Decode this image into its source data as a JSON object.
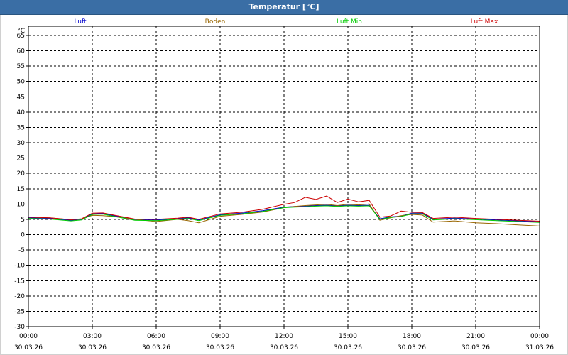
{
  "window": {
    "title": "Temperatur [°C]"
  },
  "chart_data": {
    "type": "line",
    "title": "Temperatur [°C]",
    "ylabel": "°C",
    "ylim": [
      -30,
      68
    ],
    "yticks": [
      -30,
      -25,
      -20,
      -15,
      -10,
      -5,
      0,
      5,
      10,
      15,
      20,
      25,
      30,
      35,
      40,
      45,
      50,
      55,
      60,
      65
    ],
    "xticks": [
      {
        "hour": 0,
        "time": "00:00",
        "date": "30.03.26"
      },
      {
        "hour": 3,
        "time": "03:00",
        "date": "30.03.26"
      },
      {
        "hour": 6,
        "time": "06:00",
        "date": "30.03.26"
      },
      {
        "hour": 9,
        "time": "09:00",
        "date": "30.03.26"
      },
      {
        "hour": 12,
        "time": "12:00",
        "date": "30.03.26"
      },
      {
        "hour": 15,
        "time": "15:00",
        "date": "30.03.26"
      },
      {
        "hour": 18,
        "time": "18:00",
        "date": "30.03.26"
      },
      {
        "hour": 21,
        "time": "21:00",
        "date": "30.03.26"
      },
      {
        "hour": 24,
        "time": "00:00",
        "date": "31.03.26"
      }
    ],
    "grid": true,
    "legend_position": "top",
    "x_hours": [
      0,
      1,
      2,
      2.5,
      3,
      3.5,
      4,
      5,
      6,
      7,
      7.5,
      8,
      9,
      10,
      11,
      12,
      12.5,
      13,
      13.5,
      14,
      14.5,
      15,
      15.5,
      16,
      16.5,
      17,
      17.5,
      18,
      18.5,
      19,
      20,
      21,
      22,
      23,
      24
    ],
    "series": [
      {
        "name": "Luft",
        "color": "#0000cc",
        "values": [
          5.5,
          5.3,
          4.7,
          5,
          6.8,
          6.9,
          6.2,
          4.9,
          4.8,
          5.2,
          5.5,
          4.8,
          6.5,
          7,
          7.8,
          9,
          9.2,
          9.3,
          9.5,
          9.6,
          9.4,
          9.6,
          9.5,
          9.6,
          5.2,
          5.8,
          6.1,
          7,
          7,
          5,
          5.4,
          5.1,
          4.8,
          4.5,
          4.2
        ]
      },
      {
        "name": "Boden",
        "color": "#996600",
        "values": [
          5.8,
          5.5,
          4.9,
          5.1,
          6.3,
          6.2,
          5.9,
          5,
          4.3,
          5,
          4.6,
          3.9,
          6,
          6.6,
          7.4,
          8.8,
          9.2,
          9.5,
          9.7,
          9.9,
          9.5,
          9.9,
          9.7,
          10,
          4.7,
          5.5,
          6.2,
          6.6,
          6.4,
          4.1,
          4.5,
          3.9,
          3.6,
          3.2,
          2.8
        ]
      },
      {
        "name": "Luft Min",
        "color": "#00cc00",
        "values": [
          5.3,
          5.1,
          4.5,
          4.8,
          6.6,
          6.7,
          6.0,
          4.7,
          4.6,
          5,
          5.3,
          4.6,
          6.3,
          6.8,
          7.6,
          8.8,
          9,
          9.1,
          9.3,
          9.4,
          9.2,
          9.4,
          9.3,
          9.4,
          5,
          5.6,
          5.9,
          6.8,
          6.8,
          4.8,
          5.2,
          4.9,
          4.6,
          4.3,
          4
        ]
      },
      {
        "name": "Luft Max",
        "color": "#cc0000",
        "values": [
          5.7,
          5.5,
          4.9,
          5.2,
          7,
          7.1,
          6.4,
          5.1,
          5,
          5.4,
          5.7,
          5.0,
          6.8,
          7.3,
          8.3,
          9.9,
          10.5,
          12.2,
          11.5,
          12.6,
          10.5,
          11.6,
          10.7,
          11.2,
          5.7,
          6.1,
          7.7,
          7.3,
          7.2,
          5.3,
          5.7,
          5.3,
          5.0,
          4.7,
          4.4
        ]
      }
    ]
  }
}
